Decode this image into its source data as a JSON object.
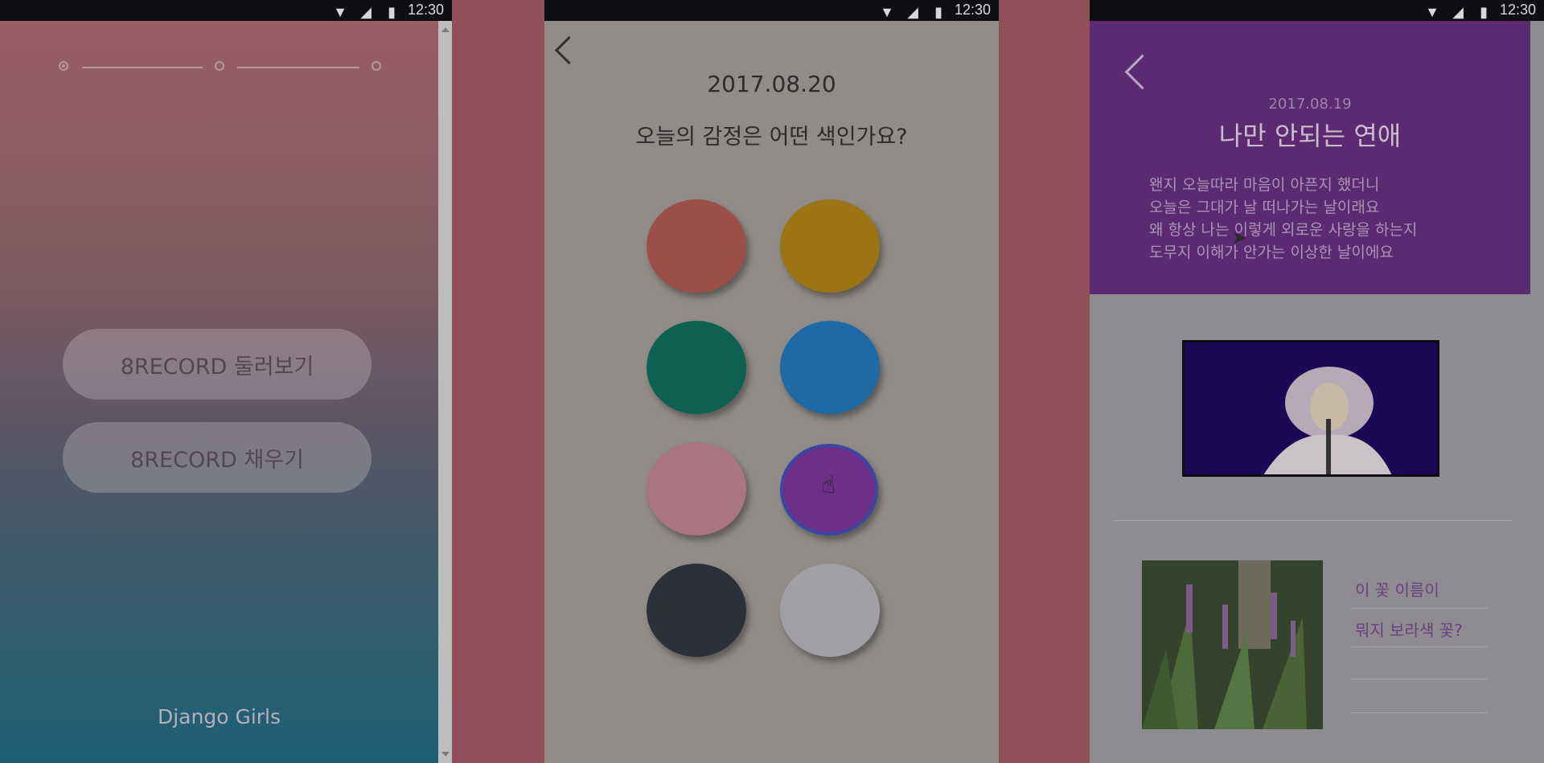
{
  "status": {
    "time": "12:30"
  },
  "screen1": {
    "buttons": [
      "8RECORD 둘러보기",
      "8RECORD 채우기"
    ],
    "footer": "Django Girls"
  },
  "screen2": {
    "date": "2017.08.20",
    "question": "오늘의 감정은 어떤 색인가요?",
    "colors": [
      {
        "name": "red",
        "hex": "#9b4f48"
      },
      {
        "name": "yellow",
        "hex": "#9b7413"
      },
      {
        "name": "green",
        "hex": "#0d6150"
      },
      {
        "name": "blue",
        "hex": "#1e6aa6"
      },
      {
        "name": "pink",
        "hex": "#a97581"
      },
      {
        "name": "purple",
        "hex": "#6e2f88",
        "selected": true
      },
      {
        "name": "black",
        "hex": "#2c3038"
      },
      {
        "name": "light-gray",
        "hex": "#a0a0a4"
      }
    ]
  },
  "screen3": {
    "date": "2017.08.19",
    "title": "나만 안되는 연애",
    "lyrics": [
      "왠지 오늘따라 마음이 아픈지 했더니",
      "오늘은 그대가 날 떠나가는 날이래요",
      "왜 항상 나는 이렇게 외로운 사랑을 하는지",
      "도무지 이해가 안가는 이상한 날이에요"
    ],
    "links": [
      "이 꽃 이름이",
      "뭐지 보라색 꽃?"
    ]
  }
}
